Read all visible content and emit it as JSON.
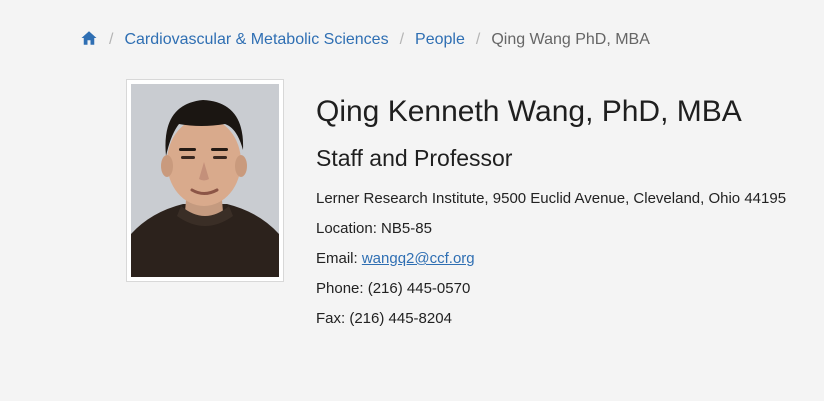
{
  "breadcrumb": {
    "home_icon": "home-icon",
    "link_color": "#2f6fb3",
    "items": [
      {
        "label": "Cardiovascular & Metabolic Sciences"
      },
      {
        "label": "People"
      },
      {
        "label": "Qing Wang PhD, MBA"
      }
    ],
    "separator": "/"
  },
  "profile": {
    "photo": "portrait-photo",
    "name": "Qing Kenneth Wang, PhD, MBA",
    "title": "Staff and Professor",
    "address": "Lerner Research Institute, 9500 Euclid Avenue, Cleveland, Ohio 44195",
    "location_label": "Location: ",
    "location": "NB5-85",
    "email_label": "Email: ",
    "email": "wangq2@ccf.org",
    "phone_label": "Phone: ",
    "phone": "(216) 445-0570",
    "fax_label": "Fax: ",
    "fax": "(216) 445-8204"
  }
}
